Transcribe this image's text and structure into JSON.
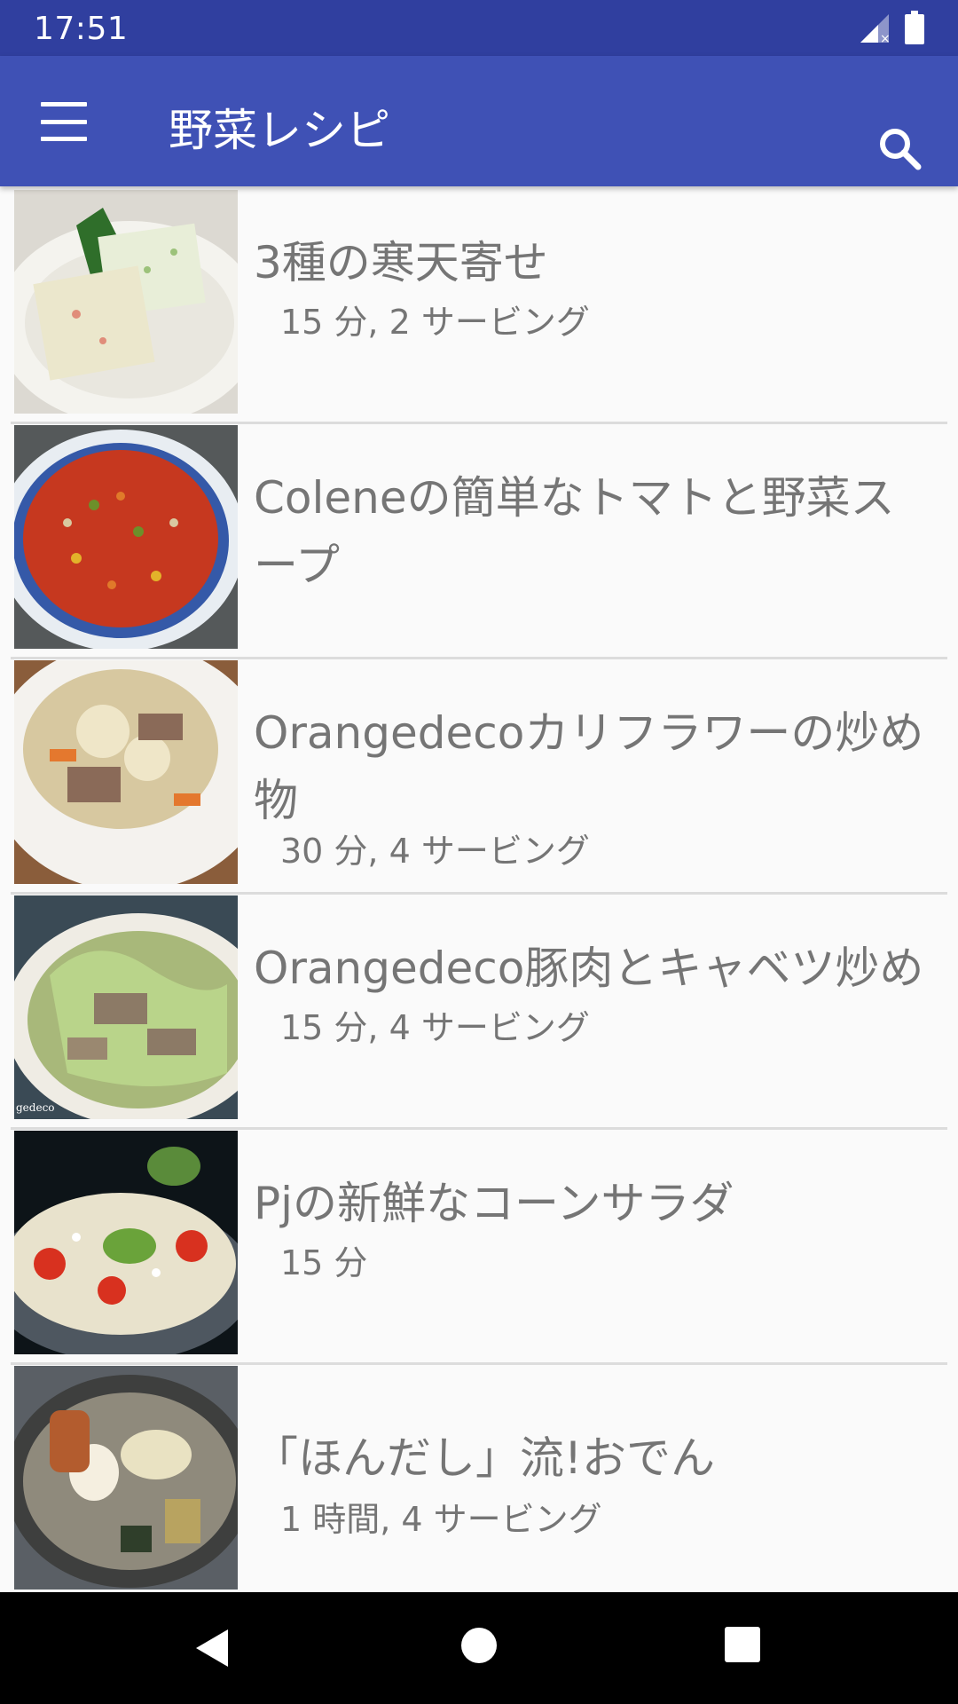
{
  "status_bar": {
    "time": "17:51"
  },
  "app_bar": {
    "title": "野菜レシピ",
    "menu_icon": "menu-icon",
    "search_icon": "search-icon"
  },
  "recipes": [
    {
      "title": "3種の寒天寄せ",
      "meta": "15 分, 2 サービング"
    },
    {
      "title": "Coleneの簡単なトマトと野菜スープ",
      "meta": ""
    },
    {
      "title": "Orangedecoカリフラワーの炒め物",
      "meta": "30 分, 4 サービング"
    },
    {
      "title": "Orangedeco豚肉とキャベツ炒め",
      "meta": "15 分, 4 サービング"
    },
    {
      "title": "Pjの新鮮なコーンサラダ",
      "meta": "15 分"
    },
    {
      "title": "「ほんだし」流!おでん",
      "meta": "1 時間, 4 サービング"
    }
  ],
  "thumb_text": {
    "recipe_4_watermark": "gedeco"
  },
  "nav_bar": {
    "back_icon": "back-icon",
    "home_icon": "home-icon",
    "recents_icon": "recents-icon"
  },
  "colors": {
    "primary": "#3f51b5",
    "primary_dark": "#303f9f",
    "text_secondary": "#757575"
  }
}
